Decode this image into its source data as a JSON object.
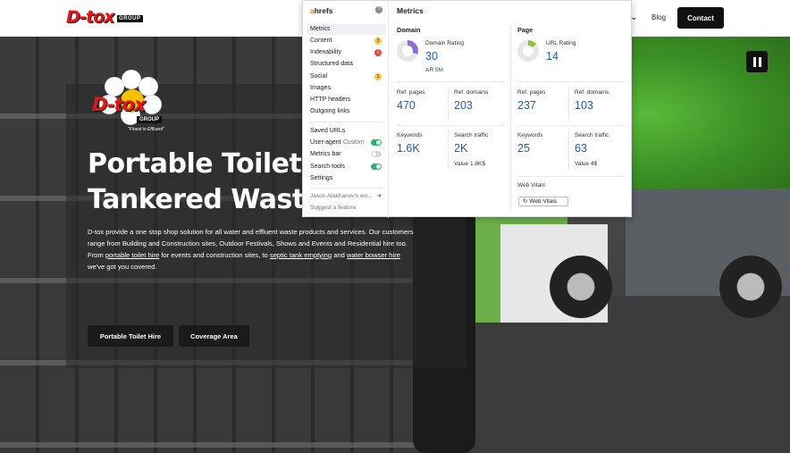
{
  "header": {
    "logo_text": "D-tox",
    "logo_sub": "GROUP",
    "nav_blog": "Blog",
    "nav_contact": "Contact",
    "chevron": "⌄"
  },
  "hero": {
    "badge_text": "D-tox",
    "badge_group": "GROUP",
    "badge_tag": "\"Finest in Effluent\"",
    "title_line1": "Portable Toilets",
    "title_line2": "Tankered Waste Services",
    "desc_1": "D-tox provide a one stop shop solution for all water and effluent waste products and services. Our customers range from Building and Construction sites, Outdoor Festivals, Shows and Events and Residential hire too. From ",
    "desc_link1": "portable toilet hire",
    "desc_2": " for events and construction sites, to ",
    "desc_link2": "septic tank emptying",
    "desc_3": " and ",
    "desc_link3": "water bowser hire",
    "desc_4": " we've got you covered.",
    "btn_hire": "Portable Toilet Hire",
    "btn_coverage": "Coverage Area"
  },
  "ahrefs": {
    "logo_a": "a",
    "logo_rest": "hrefs",
    "help": "?",
    "menu": [
      {
        "label": "Metrics"
      },
      {
        "label": "Content",
        "badge": "2",
        "badge_color": "#f7c948"
      },
      {
        "label": "Indexability",
        "badge": "1",
        "badge_color": "#e84545"
      },
      {
        "label": "Structured data"
      },
      {
        "label": "Social",
        "badge": "1",
        "badge_color": "#f7c948"
      },
      {
        "label": "Images"
      },
      {
        "label": "HTTP headers"
      },
      {
        "label": "Outgoing links"
      }
    ],
    "tools": [
      {
        "label": "Saved URLs"
      },
      {
        "label": "User-agent",
        "extra": "Custom",
        "toggle": "on"
      },
      {
        "label": "Metrics bar",
        "toggle": "off"
      },
      {
        "label": "Search tools",
        "toggle": "on"
      },
      {
        "label": "Settings"
      }
    ],
    "account": "Jason Atakhanov's wo...",
    "suggest": "Suggest a feature",
    "metrics_title": "Metrics",
    "domain": {
      "title": "Domain",
      "dr_label": "Domain Rating",
      "dr_value": "30",
      "dr_fraction": 0.3,
      "ar_label": "AR",
      "ar_value": "5M",
      "ref_pages_label": "Ref. pages",
      "ref_pages": "470",
      "ref_domains_label": "Ref. domains",
      "ref_domains": "203",
      "keywords_label": "Keywords",
      "keywords": "1.6K",
      "traffic_label": "Search traffic",
      "traffic": "2K",
      "value_label": "Value 1.8K$"
    },
    "page": {
      "title": "Page",
      "ur_label": "URL Rating",
      "ur_value": "14",
      "ur_fraction": 0.14,
      "ref_pages_label": "Ref. pages",
      "ref_pages": "237",
      "ref_domains_label": "Ref. domains",
      "ref_domains": "103",
      "keywords_label": "Keywords",
      "keywords": "25",
      "traffic_label": "Search traffic",
      "traffic": "63",
      "value_label": "Value 4$",
      "web_vitals_label": "Web Vitals",
      "web_vitals_button": "Web Vitals"
    },
    "colors": {
      "dr_ring": "#8a6fd6",
      "ur_ring": "#8cc63f",
      "link_blue": "#1e5dab",
      "accent_orange": "#f58220"
    }
  }
}
